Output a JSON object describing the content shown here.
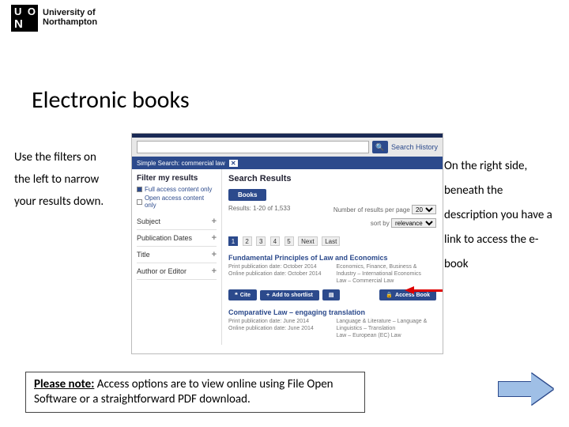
{
  "logo": {
    "u": "U",
    "o": "O",
    "n": "N",
    "text_line1": "University of",
    "text_line2": "Northampton"
  },
  "title": "Electronic books",
  "left_paragraph": "Use the filters on the left to narrow your results down.",
  "right_paragraph": "On the right side, beneath the description you have a link to access the e-book",
  "note": {
    "prefix": "Please note:",
    "body": " Access options are to view online using File Open Software or a straightforward PDF download."
  },
  "shot": {
    "search_placeholder": "",
    "go_icon": "🔍",
    "history": "Search History",
    "chip": {
      "label": "Simple Search: commercial law",
      "x": "✕"
    },
    "sidebar": {
      "heading": "Filter my results",
      "options": [
        {
          "label": "Full access content only",
          "checked": true
        },
        {
          "label": "Open access content only",
          "checked": false
        }
      ],
      "facets": [
        "Subject",
        "Publication Dates",
        "Title",
        "Author or Editor"
      ]
    },
    "results": {
      "heading": "Search Results",
      "tab": "Books",
      "count_text": "Results: 1-20 of 1,533",
      "items_per_page": "Number of results per page",
      "ipp_value": "20",
      "sort_label": "sort by",
      "sort_value": "relevance",
      "pages": [
        "1",
        "2",
        "3",
        "4",
        "5"
      ],
      "pager_next": "Next",
      "pager_last": "Last",
      "item1": {
        "title": "Fundamental Principles of Law and Economics",
        "left_lines": [
          "Print publication date: October 2014",
          "Online publication date: October 2014"
        ],
        "right_lines": [
          "Economics, Finance, Business &",
          "Industry – International Economics",
          "Law – Commercial Law"
        ]
      },
      "buttons": {
        "cite": "Cite",
        "shortlist": "Add to shortlist",
        "access": "Access Book"
      },
      "item2": {
        "title": "Comparative Law – engaging translation",
        "left_lines": [
          "Print publication date: June 2014",
          "Online publication date: June 2014"
        ],
        "right_lines": [
          "Language & Literature – Language &",
          "Linguistics – Translation",
          "Law – European (EC) Law"
        ]
      }
    }
  }
}
